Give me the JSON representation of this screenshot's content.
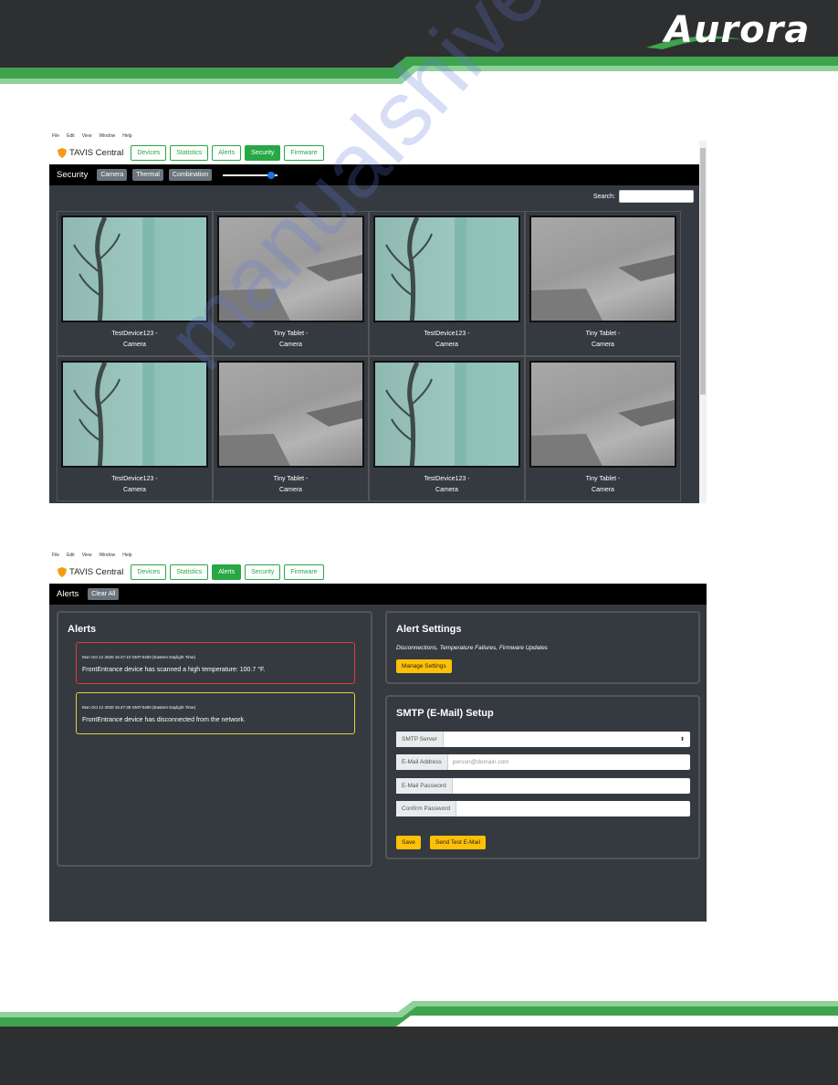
{
  "brand": {
    "logo_text": "Aurora"
  },
  "menu": [
    "File",
    "Edit",
    "View",
    "Window",
    "Help"
  ],
  "app_name": "TAVIS Central",
  "tabs": [
    "Devices",
    "Statistics",
    "Alerts",
    "Security",
    "Firmware"
  ],
  "security_view": {
    "active_tab": "Security",
    "subbar_title": "Security",
    "filters": [
      "Camera",
      "Thermal",
      "Combination"
    ],
    "slider_value": 0.88,
    "search_label": "Search:",
    "search_value": "",
    "cells": [
      {
        "line1": "TestDevice123 -",
        "line2": "Camera",
        "image": "tree"
      },
      {
        "line1": "Tiny Tablet -",
        "line2": "Camera",
        "image": "wall"
      },
      {
        "line1": "TestDevice123 -",
        "line2": "Camera",
        "image": "tree"
      },
      {
        "line1": "Tiny Tablet -",
        "line2": "Camera",
        "image": "wall"
      },
      {
        "line1": "TestDevice123 -",
        "line2": "Camera",
        "image": "tree"
      },
      {
        "line1": "Tiny Tablet -",
        "line2": "Camera",
        "image": "wall"
      },
      {
        "line1": "TestDevice123 -",
        "line2": "Camera",
        "image": "tree"
      },
      {
        "line1": "Tiny Tablet -",
        "line2": "Camera",
        "image": "wall"
      }
    ]
  },
  "alerts_view": {
    "active_tab": "Alerts",
    "subbar_title": "Alerts",
    "clear_all": "Clear All",
    "panel_title": "Alerts",
    "alerts": [
      {
        "time": "Mon Oct 12 2020 15:47:10 GMT-0400 (Eastern Daylight Time)",
        "message": "FrontEntrance device has scanned a high temperature: 100.7 °F.",
        "level": "red"
      },
      {
        "time": "Mon Oct 12 2020 15:47:39 GMT-0400 (Eastern Daylight Time)",
        "message": "FrontEntrance device has disconnected from the network.",
        "level": "yellow"
      }
    ],
    "settings": {
      "title": "Alert Settings",
      "subtitle": "Disconnections, Temperature Failures, Firmware Updates",
      "manage_button": "Manage Settings"
    },
    "smtp": {
      "title": "SMTP (E-Mail) Setup",
      "server_label": "SMTP Server",
      "email_label": "E-Mail Address",
      "email_placeholder": "person@domain.com",
      "password_label": "E-Mail Password",
      "confirm_label": "Confirm Password",
      "save_button": "Save",
      "test_button": "Send Test E-Mail"
    }
  },
  "watermark": "manualshive.com",
  "colors": {
    "green": "#28a745",
    "yellow": "#ffc107",
    "alert_red": "#e53935",
    "alert_yellow": "#e0d23a",
    "dark_bg": "#343a40"
  }
}
